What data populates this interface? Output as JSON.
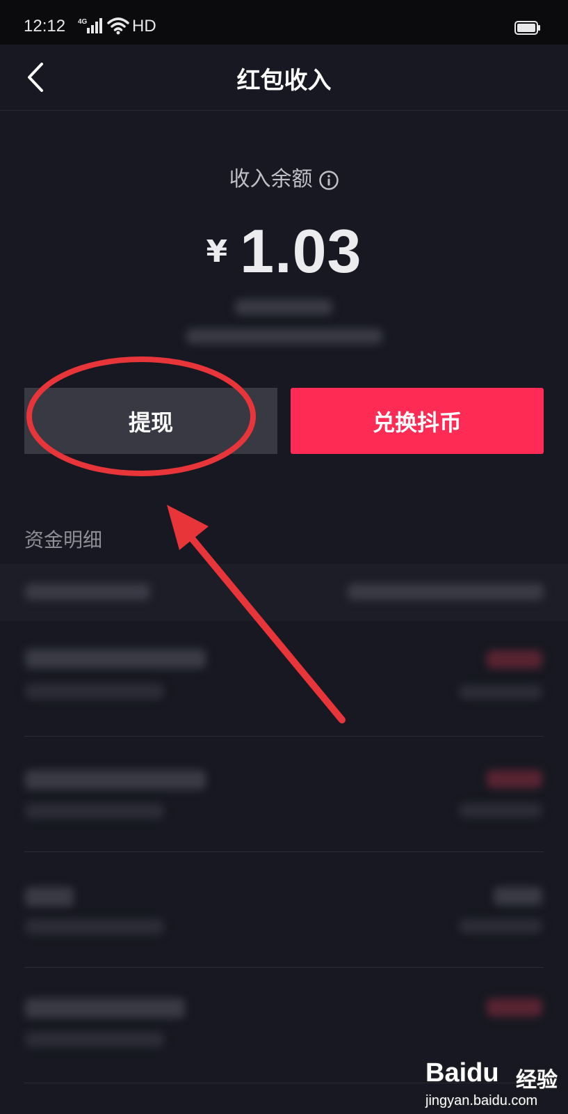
{
  "status_bar": {
    "time": "12:12",
    "network": "4G",
    "hd": "HD"
  },
  "nav": {
    "title": "红包收入"
  },
  "balance": {
    "label": "收入余额",
    "currency": "¥",
    "amount": "1.03"
  },
  "actions": {
    "withdraw_label": "提现",
    "exchange_label": "兑换抖币"
  },
  "section": {
    "title": "资金明细"
  },
  "watermark": {
    "logo": "Baidu",
    "logo_cn": "经验",
    "url": "jingyan.baidu.com"
  },
  "colors": {
    "background": "#171821",
    "accent": "#fe2c55",
    "annotation": "#e8353a"
  }
}
